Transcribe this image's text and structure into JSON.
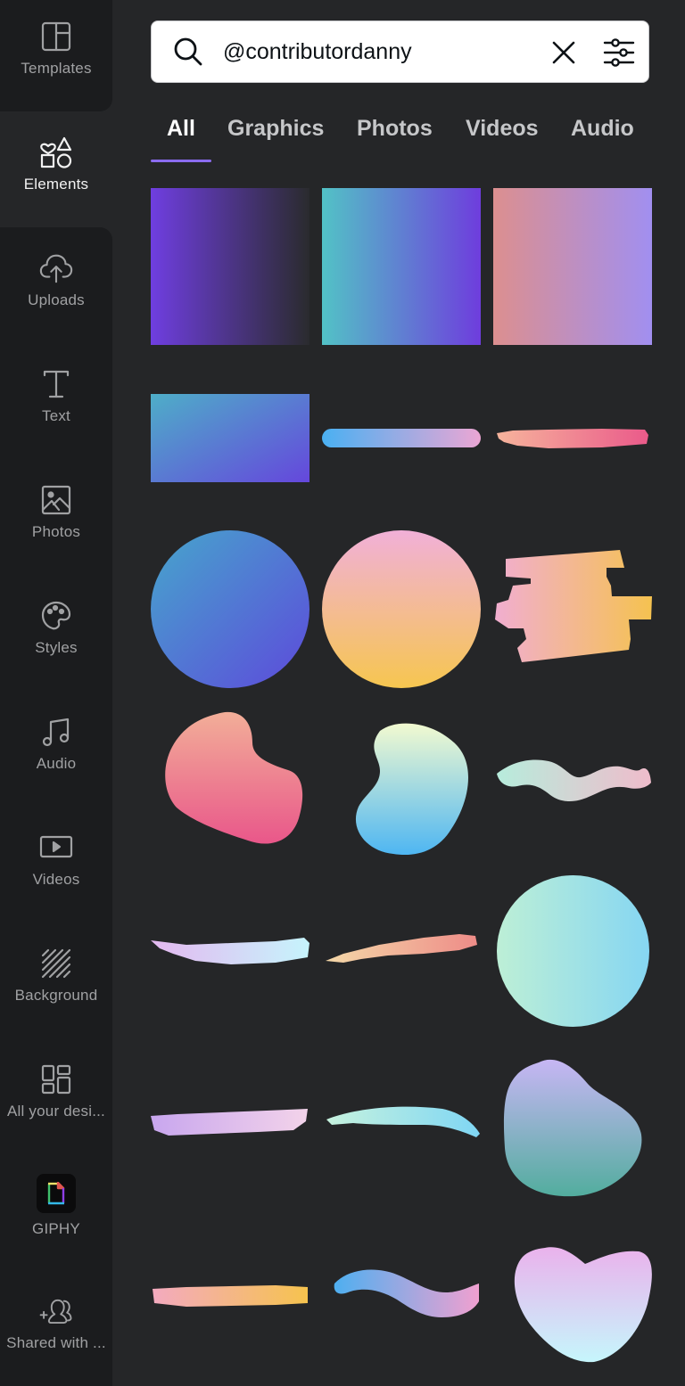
{
  "sidebar": {
    "items": [
      {
        "label": "Templates",
        "icon": "templates-icon",
        "active": false
      },
      {
        "label": "Elements",
        "icon": "elements-icon",
        "active": true
      },
      {
        "label": "Uploads",
        "icon": "upload-cloud-icon",
        "active": false
      },
      {
        "label": "Text",
        "icon": "text-icon",
        "active": false
      },
      {
        "label": "Photos",
        "icon": "photo-icon",
        "active": false
      },
      {
        "label": "Styles",
        "icon": "palette-icon",
        "active": false
      },
      {
        "label": "Audio",
        "icon": "music-note-icon",
        "active": false
      },
      {
        "label": "Videos",
        "icon": "video-play-icon",
        "active": false
      },
      {
        "label": "Background",
        "icon": "hatch-pattern-icon",
        "active": false
      },
      {
        "label": "All your desi...",
        "icon": "grid-layout-icon",
        "active": false
      },
      {
        "label": "GIPHY",
        "icon": "giphy-logo-icon",
        "active": false
      },
      {
        "label": "Shared with ...",
        "icon": "add-people-icon",
        "active": false
      }
    ]
  },
  "search": {
    "value": "@contributordanny",
    "icon": "search-icon",
    "clear_icon": "close-icon",
    "filter_icon": "sliders-filter-icon"
  },
  "tabs": [
    {
      "label": "All",
      "active": true
    },
    {
      "label": "Graphics",
      "active": false
    },
    {
      "label": "Photos",
      "active": false
    },
    {
      "label": "Videos",
      "active": false
    },
    {
      "label": "Audio",
      "active": false
    }
  ],
  "accent_color": "#8b6cf0",
  "results": [
    {
      "name": "purple-to-dark-gradient-square",
      "colors": [
        "#6f3ee0",
        "#2a2b2e"
      ]
    },
    {
      "name": "teal-to-purple-gradient-square",
      "colors": [
        "#52c2c6",
        "#6e3ddd"
      ]
    },
    {
      "name": "salmon-to-lavender-gradient-square",
      "colors": [
        "#dc8f8f",
        "#a18ff0"
      ]
    },
    {
      "name": "teal-to-indigo-gradient-rectangle",
      "colors": [
        "#4eaec8",
        "#6547dc"
      ]
    },
    {
      "name": "blue-to-pink-gradient-bar",
      "colors": [
        "#4ab0f2",
        "#eba6d4"
      ]
    },
    {
      "name": "peach-to-pink-brush-stroke",
      "colors": [
        "#f6b49c",
        "#ea5a8a"
      ]
    },
    {
      "name": "blue-to-indigo-gradient-circle",
      "colors": [
        "#46a6cc",
        "#5d4adb"
      ]
    },
    {
      "name": "pink-to-yellow-gradient-circle",
      "colors": [
        "#f1b0d8",
        "#f6c650"
      ]
    },
    {
      "name": "pink-to-yellow-brush-scribble",
      "colors": [
        "#f1aed0",
        "#f5c250"
      ]
    },
    {
      "name": "peach-to-pink-gradient-blob",
      "colors": [
        "#f2ae98",
        "#e9578a"
      ]
    },
    {
      "name": "yellow-to-blue-gradient-blob",
      "colors": [
        "#f2fad0",
        "#4eb6f2"
      ]
    },
    {
      "name": "mint-to-pink-wavy-brush-stroke",
      "colors": [
        "#b7ecdc",
        "#efbccb"
      ]
    },
    {
      "name": "lavender-to-aqua-brush-stroke",
      "colors": [
        "#e4b8f0",
        "#c6f4fc"
      ]
    },
    {
      "name": "yellow-to-coral-brush-stroke",
      "colors": [
        "#f4d8a8",
        "#ee8c88"
      ]
    },
    {
      "name": "mint-to-sky-brush-circle",
      "colors": [
        "#bdefd6",
        "#86d6f2"
      ]
    },
    {
      "name": "lilac-to-pink-dry-brush-stroke",
      "colors": [
        "#c8a6ee",
        "#f3d3ea"
      ]
    },
    {
      "name": "mint-to-sky-dry-brush-stroke",
      "colors": [
        "#c6f2de",
        "#7fd6f4"
      ]
    },
    {
      "name": "lavender-to-teal-gradient-blob",
      "colors": [
        "#c7b6f4",
        "#52ad9e"
      ]
    },
    {
      "name": "pink-to-yellow-dry-brush-stroke",
      "colors": [
        "#f3aac0",
        "#f6c34e"
      ]
    },
    {
      "name": "blue-to-pink-wave-brush-stroke",
      "colors": [
        "#4eaff0",
        "#f0a0d0"
      ]
    },
    {
      "name": "pink-to-aqua-heart-blob",
      "colors": [
        "#eab2ec",
        "#c6f6fc"
      ]
    }
  ]
}
